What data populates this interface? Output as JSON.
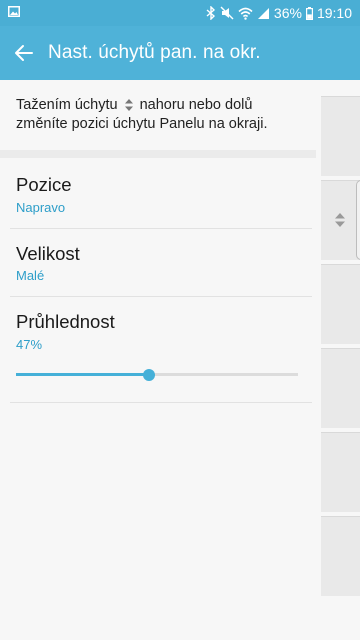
{
  "status_bar": {
    "battery_percent": "36%",
    "time": "19:10",
    "icons": [
      "gallery-icon",
      "bluetooth-icon",
      "mute-icon",
      "wifi-icon",
      "signal-icon",
      "battery-icon"
    ]
  },
  "app_bar": {
    "title": "Nast. úchytů pan. na okr.",
    "back_icon": "arrow-back-icon"
  },
  "description": {
    "before_icon": "Tažením úchytu",
    "after_icon": "nahoru nebo dolů změníte pozici úchytu Panelu na okraji."
  },
  "settings": {
    "position": {
      "label": "Pozice",
      "value": "Napravo"
    },
    "size": {
      "label": "Velikost",
      "value": "Malé"
    },
    "transparency": {
      "label": "Průhlednost",
      "value": "47%",
      "level": 0.47
    }
  },
  "colors": {
    "accent": "#45b0d8",
    "app_bar": "#4fb2d8",
    "status_bar": "#4aaed4",
    "value_text": "#2d9ec9"
  }
}
